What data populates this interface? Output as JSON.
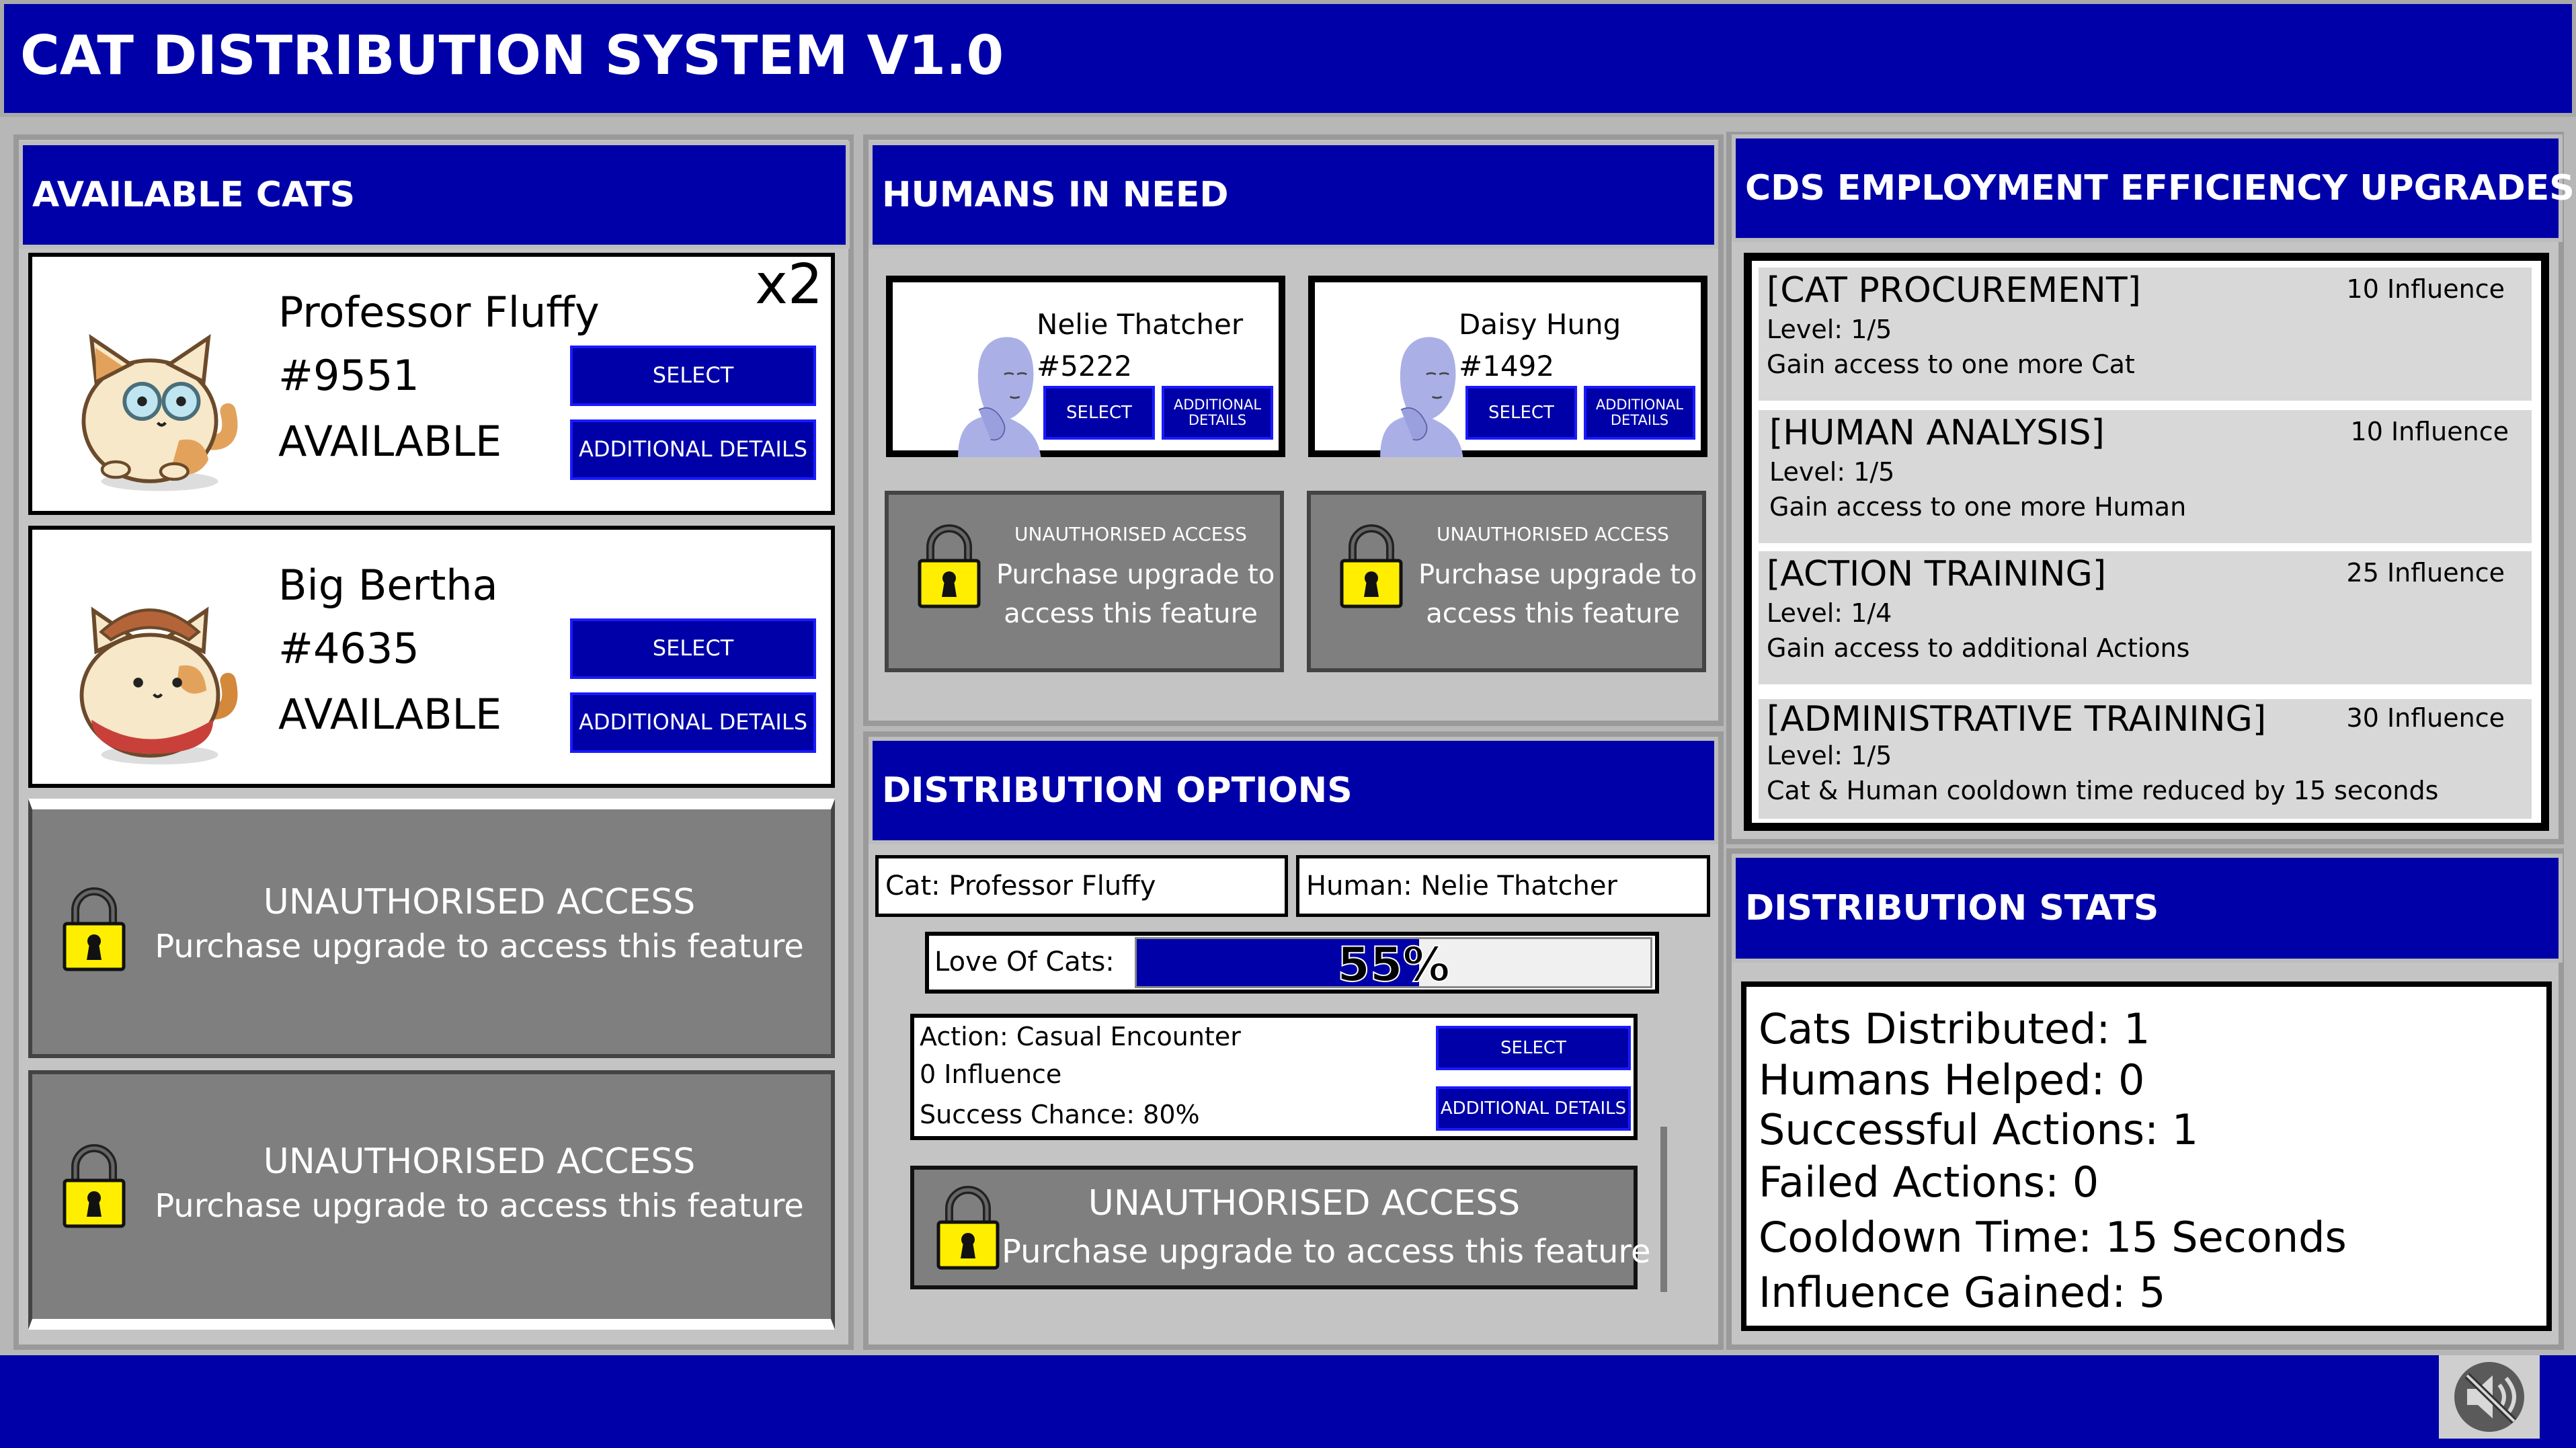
{
  "app": {
    "title": "CAT DISTRIBUTION SYSTEM V1.0"
  },
  "cats": {
    "header": "AVAILABLE CATS",
    "multiplier": "x2",
    "items": [
      {
        "name": "Professor Fluffy",
        "id": "#9551",
        "status": "AVAILABLE",
        "select": "SELECT",
        "details": "ADDITIONAL DETAILS"
      },
      {
        "name": "Big Bertha",
        "id": "#4635",
        "status": "AVAILABLE",
        "select": "SELECT",
        "details": "ADDITIONAL DETAILS"
      }
    ],
    "locked": [
      {
        "title": "UNAUTHORISED ACCESS",
        "text": "Purchase upgrade to access this feature"
      },
      {
        "title": "UNAUTHORISED ACCESS",
        "text": "Purchase upgrade to access this feature"
      }
    ]
  },
  "humans": {
    "header": "HUMANS IN NEED",
    "items": [
      {
        "name": "Nelie Thatcher",
        "id": "#5222",
        "select": "SELECT",
        "details_1": "ADDITIONAL",
        "details_2": "DETAILS"
      },
      {
        "name": "Daisy Hung",
        "id": "#1492",
        "select": "SELECT",
        "details_1": "ADDITIONAL",
        "details_2": "DETAILS"
      }
    ],
    "locked": [
      {
        "title": "UNAUTHORISED ACCESS",
        "text_1": "Purchase upgrade to",
        "text_2": "access this feature"
      },
      {
        "title": "UNAUTHORISED ACCESS",
        "text_1": "Purchase upgrade to",
        "text_2": "access this feature"
      }
    ]
  },
  "distribution": {
    "header": "DISTRIBUTION OPTIONS",
    "cat_field": "Cat: Professor Fluffy",
    "human_field": "Human: Nelie Thatcher",
    "love_label": "Love Of Cats:",
    "love_value": "55%",
    "love_fraction": 0.55,
    "action": {
      "name": "Action: Casual Encounter",
      "influence": "0 Influence",
      "success": "Success Chance: 80%",
      "select": "SELECT",
      "details": "ADDITIONAL DETAILS"
    },
    "locked": {
      "title": "UNAUTHORISED ACCESS",
      "text": "Purchase upgrade to access this feature"
    }
  },
  "upgrades": {
    "header": "CDS EMPLOYMENT EFFICIENCY UPGRADES",
    "items": [
      {
        "name": "[CAT PROCUREMENT]",
        "cost": "10 Influence",
        "level": "Level: 1/5",
        "desc": "Gain access to one more Cat"
      },
      {
        "name": "[HUMAN ANALYSIS]",
        "cost": "10 Influence",
        "level": "Level: 1/5",
        "desc": "Gain access to one more Human"
      },
      {
        "name": "[ACTION TRAINING]",
        "cost": "25 Influence",
        "level": "Level: 1/4",
        "desc": "Gain access to additional Actions"
      },
      {
        "name": "[ADMINISTRATIVE TRAINING]",
        "cost": "30 Influence",
        "level": "Level: 1/5",
        "desc": "Cat & Human cooldown time reduced by 15 seconds"
      }
    ]
  },
  "stats": {
    "header": "DISTRIBUTION STATS",
    "lines": [
      "Cats Distributed: 1",
      "Humans Helped: 0",
      "Successful Actions: 1",
      "Failed Actions: 0",
      "Cooldown Time: 15 Seconds",
      "Influence Gained: 5"
    ]
  },
  "icons": {
    "lock": "padlock-icon",
    "mute": "speaker-muted-icon"
  },
  "colors": {
    "primary": "#0000a8",
    "panel": "#c4c4c4",
    "locked": "#7f7f7f",
    "lock_yellow": "#ffee00"
  }
}
